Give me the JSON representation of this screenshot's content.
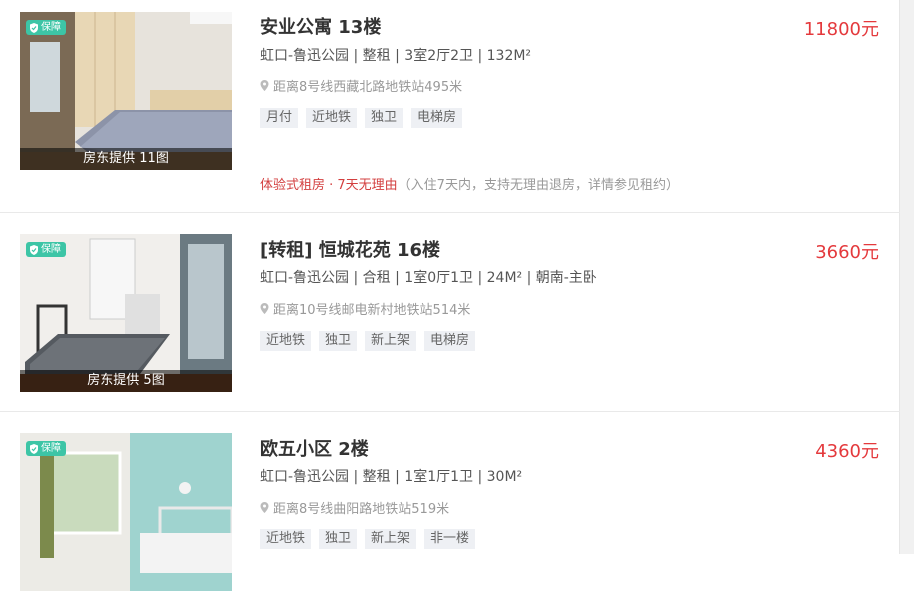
{
  "listings": [
    {
      "title": "安业公寓 13楼",
      "price": "11800元",
      "meta": "虹口-鲁迅公园 | 整租 | 3室2厅2卫 | 132M²",
      "subway": "距离8号线西藏北路地铁站495米",
      "tags": [
        "月付",
        "近地铁",
        "独卫",
        "电梯房"
      ],
      "badge": "保障",
      "photo_caption": "房东提供 11图",
      "promo_red": "体验式租房 · 7天无理由",
      "promo_note": "（入住7天内，支持无理由退房，详情参见租约）"
    },
    {
      "title": "[转租] 恒城花苑 16楼",
      "price": "3660元",
      "meta": "虹口-鲁迅公园 | 合租 | 1室0厅1卫 | 24M² | 朝南-主卧",
      "subway": "距离10号线邮电新村地铁站514米",
      "tags": [
        "近地铁",
        "独卫",
        "新上架",
        "电梯房"
      ],
      "badge": "保障",
      "photo_caption": "房东提供 5图"
    },
    {
      "title": "欧五小区 2楼",
      "price": "4360元",
      "meta": "虹口-鲁迅公园 | 整租 | 1室1厅1卫 | 30M²",
      "subway": "距离8号线曲阳路地铁站519米",
      "tags": [
        "近地铁",
        "独卫",
        "新上架",
        "非一楼"
      ],
      "badge": "保障"
    }
  ],
  "icons": {
    "badge": "shield-check-icon",
    "location": "map-pin-icon"
  },
  "colors": {
    "price": "#e4393c",
    "badge": "#3dc5a6",
    "promo": "#d33f3f"
  }
}
